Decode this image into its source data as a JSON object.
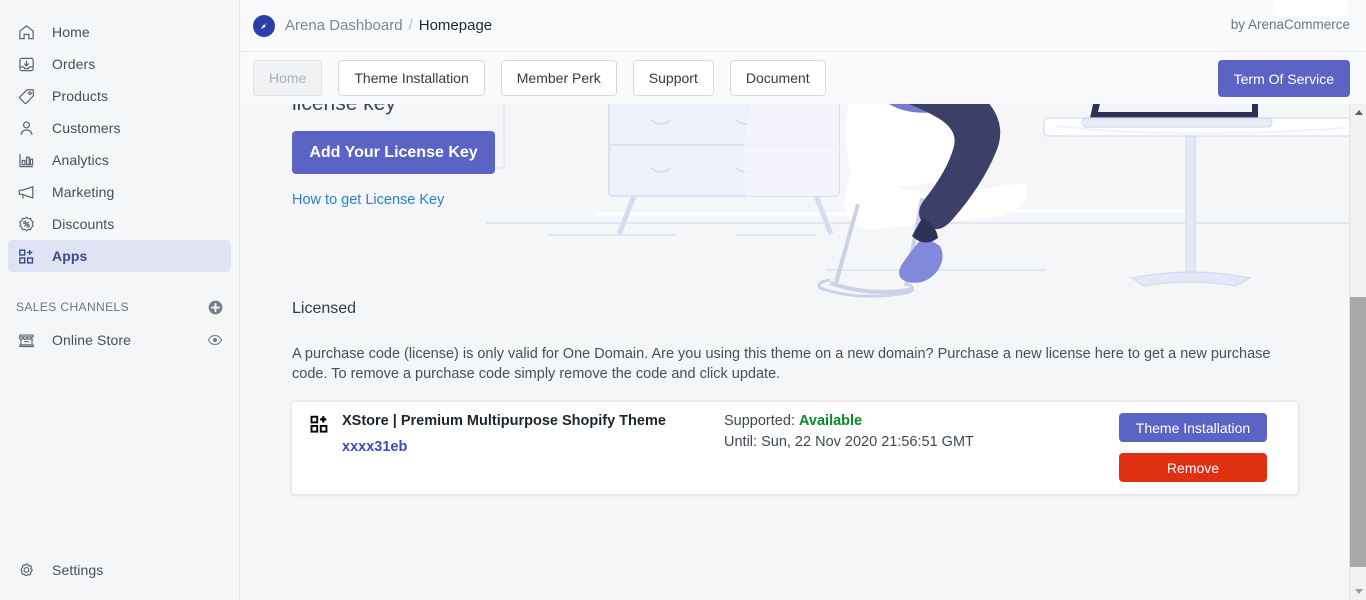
{
  "sidebar": {
    "items": [
      {
        "label": "Home",
        "icon": "home-icon",
        "active": false
      },
      {
        "label": "Orders",
        "icon": "orders-icon",
        "active": false
      },
      {
        "label": "Products",
        "icon": "products-icon",
        "active": false
      },
      {
        "label": "Customers",
        "icon": "customers-icon",
        "active": false
      },
      {
        "label": "Analytics",
        "icon": "analytics-icon",
        "active": false
      },
      {
        "label": "Marketing",
        "icon": "marketing-icon",
        "active": false
      },
      {
        "label": "Discounts",
        "icon": "discounts-icon",
        "active": false
      },
      {
        "label": "Apps",
        "icon": "apps-icon",
        "active": true
      }
    ],
    "sales_channels": {
      "title": "SALES CHANNELS",
      "add_icon": "plus-circle-icon",
      "channels": [
        {
          "label": "Online Store",
          "icon": "storefront-icon",
          "action_icon": "eye-icon"
        }
      ]
    },
    "settings": {
      "label": "Settings",
      "icon": "gear-icon"
    }
  },
  "header": {
    "logo_icon": "rocket-circle-icon",
    "breadcrumb_root": "Arena Dashboard",
    "breadcrumb_separator": "/",
    "breadcrumb_current": "Homepage",
    "byline": "by ArenaCommerce"
  },
  "tabs": [
    {
      "label": "Home",
      "disabled": true
    },
    {
      "label": "Theme Installation",
      "disabled": false
    },
    {
      "label": "Member Perk",
      "disabled": false
    },
    {
      "label": "Support",
      "disabled": false
    },
    {
      "label": "Document",
      "disabled": false
    }
  ],
  "tos_button": {
    "label": "Term Of Service"
  },
  "hero": {
    "heading": "license key",
    "add_button": "Add Your License Key",
    "how_link": "How to get License Key",
    "illustration": "person-at-desk-illustration"
  },
  "licensed": {
    "title": "Licensed",
    "description": "A purchase code (license) is only valid for One Domain. Are you using this theme on a new domain? Purchase a new license here to get a new purchase code. To remove a purchase code simply remove the code and click update.",
    "card": {
      "app_icon": "apps-grid-icon",
      "theme_name": "XStore | Premium Multipurpose Shopify Theme",
      "purchase_code": "xxxx31eb",
      "supported_label": "Supported:",
      "supported_value": "Available",
      "until_label": "Until:",
      "until_value": "Sun, 22 Nov 2020 21:56:51 GMT",
      "install_button": "Theme Installation",
      "remove_button": "Remove"
    }
  },
  "colors": {
    "accent_purple": "#5b64c5",
    "danger_red": "#e03012",
    "success_green": "#0a8a27",
    "link_blue": "#2a7fd4",
    "code_blue": "#3b4cc0",
    "sidebar_bg": "#f4f6f8",
    "active_nav_bg": "#dfe3f3"
  },
  "scrollbar": {
    "orientation": "vertical",
    "position_pct": 40
  }
}
